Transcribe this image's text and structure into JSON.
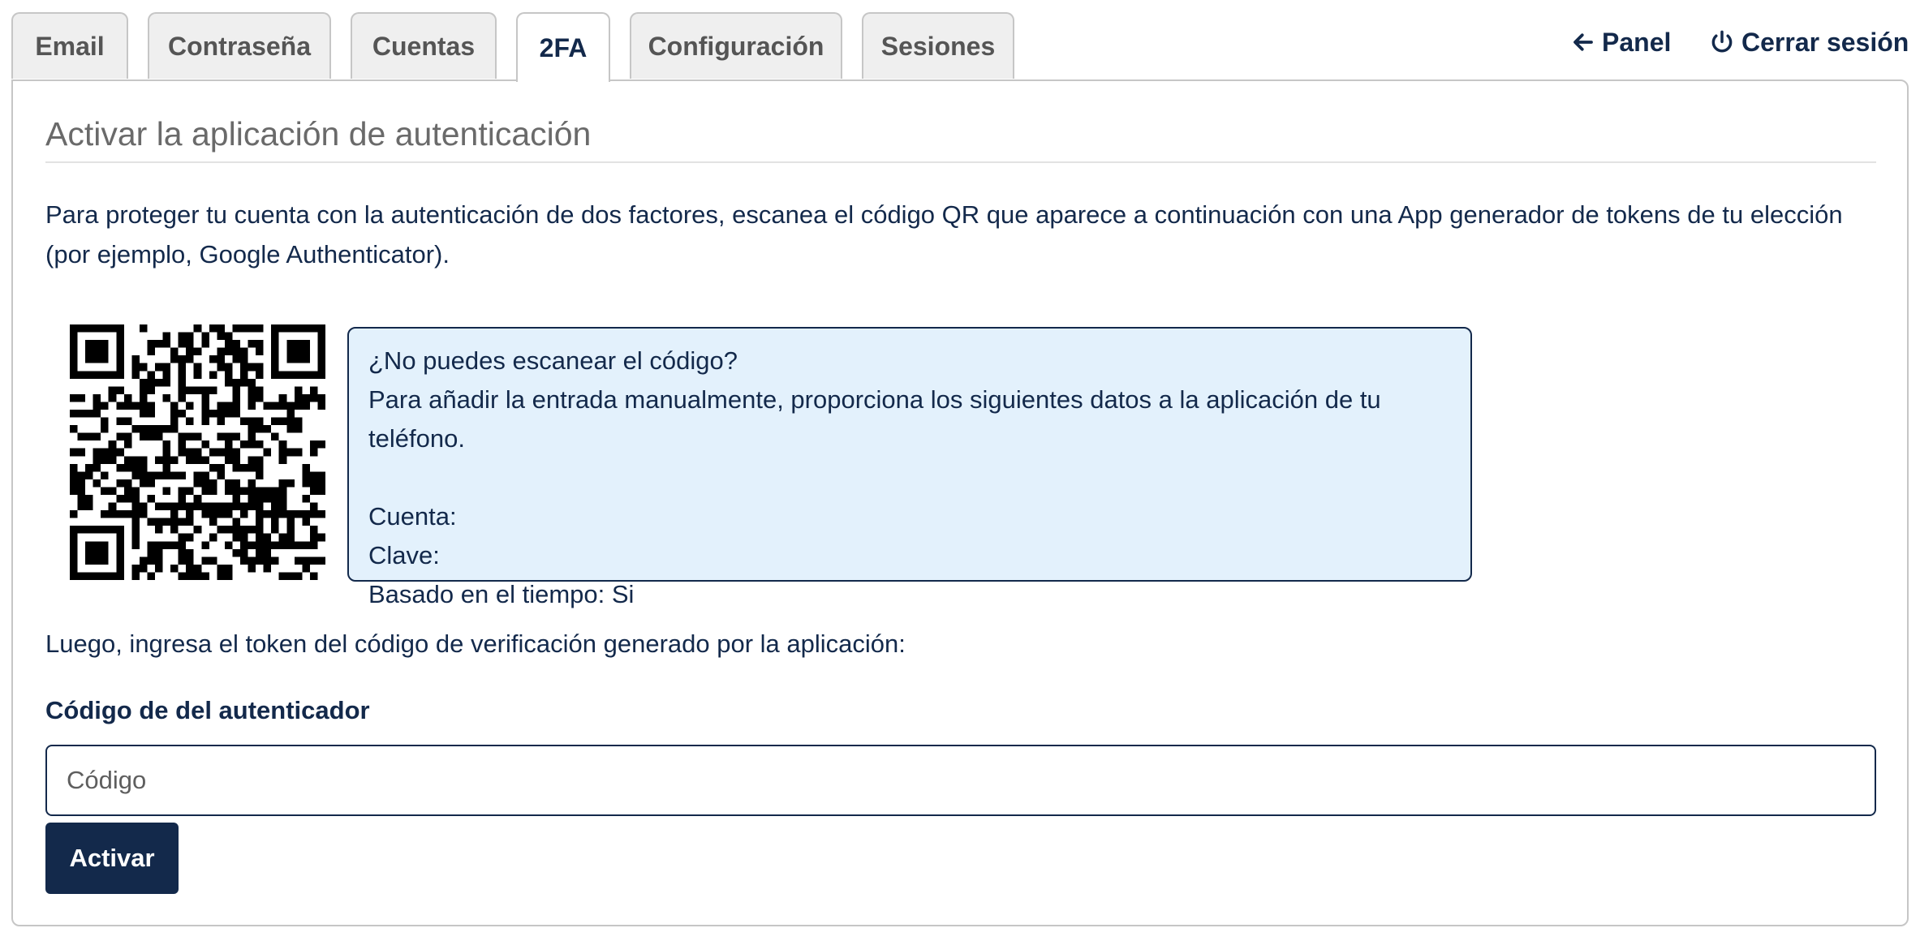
{
  "tabs": [
    {
      "label": "Email",
      "active": false
    },
    {
      "label": "Contraseña",
      "active": false
    },
    {
      "label": "Cuentas",
      "active": false
    },
    {
      "label": "2FA",
      "active": true
    },
    {
      "label": "Configuración",
      "active": false
    },
    {
      "label": "Sesiones",
      "active": false
    }
  ],
  "topnav": {
    "panel_label": "Panel",
    "panel_icon": "arrow-left-icon",
    "logout_label": "Cerrar sesión",
    "logout_icon": "power-icon"
  },
  "main": {
    "title": "Activar la aplicación de autenticación",
    "intro": "Para proteger tu cuenta con la autenticación de dos factores, escanea el código QR que aparece a continuación con una App generador de tokens de tu elección (por ejemplo, Google Authenticator).",
    "qr_icon": "qr-code-icon",
    "info": {
      "line1": "¿No puedes escanear el código?",
      "line2": "Para añadir la entrada manualmente, proporciona los siguientes datos a la aplicación de tu teléfono.",
      "account": "Cuenta:",
      "key": "Clave:",
      "time_based": "Basado en el tiempo: Si"
    },
    "after_text": "Luego, ingresa el token del código de verificación generado por la aplicación:",
    "code_label": "Código de del autenticador",
    "code_placeholder": "Código",
    "code_value": "",
    "activate_label": "Activar"
  },
  "colors": {
    "primary": "#13294b",
    "info_bg": "#e3f1fc",
    "tab_bg": "#efefef",
    "border": "#c6c6c6"
  }
}
